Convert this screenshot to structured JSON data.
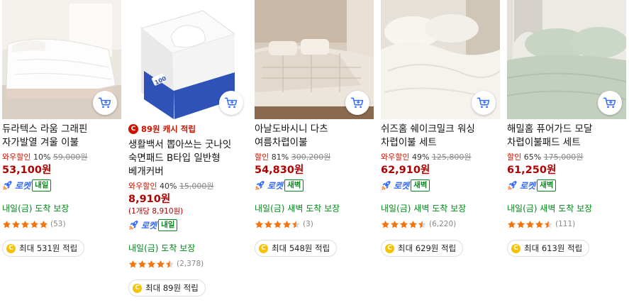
{
  "colors": {
    "discount_red": "#cb1400",
    "price_red": "#ae0000",
    "rocket_blue": "#346aff",
    "delivery_green": "#00891a"
  },
  "products": [
    {
      "title": "듀라텍스 라움 그래핀 자가발열 겨울 이불",
      "discount_label": "와우할인",
      "discount_pct": "10%",
      "original_price": "59,000원",
      "price": "53,100원",
      "badge": "로켓",
      "badge_sub": "내일",
      "delivery": "내일(금) 도착 보장",
      "rating": 5,
      "reviews": "(53)",
      "reward": "최대 531원 적립"
    },
    {
      "cash_text": "89원 캐시 적립",
      "title": "생활백서 뽑아쓰는 굿나잇 숙면패드 B타입 일반형 베개커버",
      "discount_label": "와우할인",
      "discount_pct": "40%",
      "original_price": "15,000원",
      "price": "8,910원",
      "unit_price": "(1개당 8,910원)",
      "badge": "로켓",
      "badge_sub": "내일",
      "delivery": "내일(금) 도착 보장",
      "rating": 4.5,
      "reviews": "(2,378)",
      "reward": "최대 89원 적립",
      "box_label": "100"
    },
    {
      "title": "아날도바시니 다츠 여름차렵이불",
      "discount_label": "할인",
      "discount_pct": "81%",
      "original_price": "300,200원",
      "price": "54,830원",
      "badge": "로켓",
      "badge_sub": "새벽",
      "delivery": "내일(금) 새벽 도착 보장",
      "rating": 4.5,
      "reviews": "(3)",
      "reward": "최대 548원 적립"
    },
    {
      "title": "쉬즈홈 쉐이크밀크 워싱 차렵이불 세트",
      "discount_label": "와우할인",
      "discount_pct": "49%",
      "original_price": "125,800원",
      "price": "62,910원",
      "badge": "로켓",
      "badge_sub": "새벽",
      "delivery": "내일(금) 새벽 도착 보장",
      "rating": 4.5,
      "reviews": "(6,220)",
      "reward": "최대 629원 적립"
    },
    {
      "title": "해밀홈 퓨어가드 모달 차렵이불패드 세트",
      "discount_label": "할인",
      "discount_pct": "65%",
      "original_price": "175,000원",
      "price": "61,250원",
      "badge": "로켓",
      "badge_sub": "새벽",
      "delivery": "내일(금) 새벽 도착 보장",
      "rating": 4.5,
      "reviews": "(111)",
      "reward": "최대 613원 적립"
    }
  ]
}
